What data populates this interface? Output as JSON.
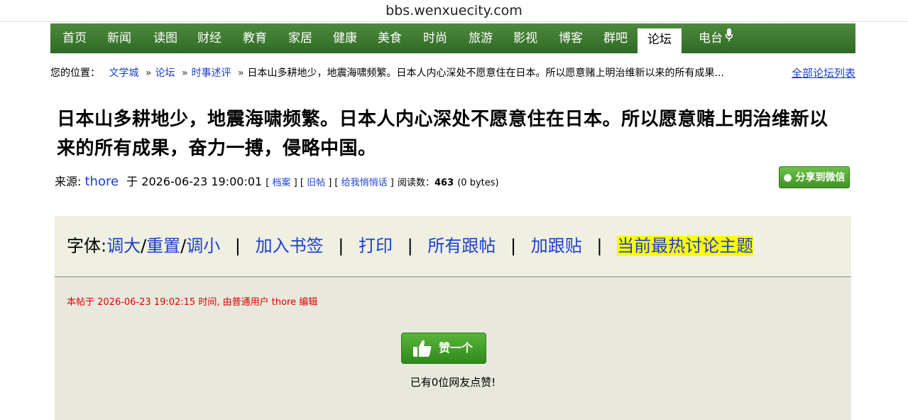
{
  "browser": {
    "url": "bbs.wenxuecity.com"
  },
  "nav": {
    "items": [
      "首页",
      "新闻",
      "读图",
      "财经",
      "教育",
      "家居",
      "健康",
      "美食",
      "时尚",
      "旅游",
      "影视",
      "博客",
      "群吧",
      "论坛",
      "电台"
    ],
    "active": "论坛",
    "mic_icon": "microphone-icon"
  },
  "breadcrumb": {
    "prefix": "您的位置：",
    "links": [
      "文学城",
      "论坛",
      "时事述评"
    ],
    "separator": "»",
    "current": "日本山多耕地少，地震海啸频繁。日本人内心深处不愿意住在日本。所以愿意赌上明治维新以来的所有成果...",
    "all_forums": "全部论坛列表"
  },
  "post": {
    "title": "日本山多耕地少，地震海啸频繁。日本人内心深处不愿意住在日本。所以愿意赌上明治维新以来的所有成果，奋力一搏，侵略中国。",
    "source_label": "来源:",
    "author": "thore",
    "at": "于",
    "datetime": "2026-06-23 19:00:01",
    "archive": "档案",
    "old_posts": "旧帖",
    "whisper": "给我悄悄话",
    "reads_label": "阅读数：",
    "reads": "463",
    "size": "(0 bytes)",
    "share_wechat": "分享到微信",
    "edit_note": "本帖于 2026-06-23 19:02:15 时间, 由普通用户 thore 编辑"
  },
  "toolbar": {
    "font_label": "字体:",
    "bigger": "调大",
    "reset": "重置",
    "smaller": "调小",
    "bookmark": "加入书签",
    "print": "打印",
    "all_replies": "所有跟帖",
    "reply": "加跟贴",
    "hot_topics": "当前最热讨论主题"
  },
  "like": {
    "button": "赞一个",
    "count_text": "已有0位网友点赞!",
    "icon": "thumbs-up-icon"
  },
  "colors": {
    "nav_green": "#3d7a2f",
    "link_blue": "#1c3fcc",
    "highlight": "#ffff00",
    "edit_red": "#e00000"
  }
}
